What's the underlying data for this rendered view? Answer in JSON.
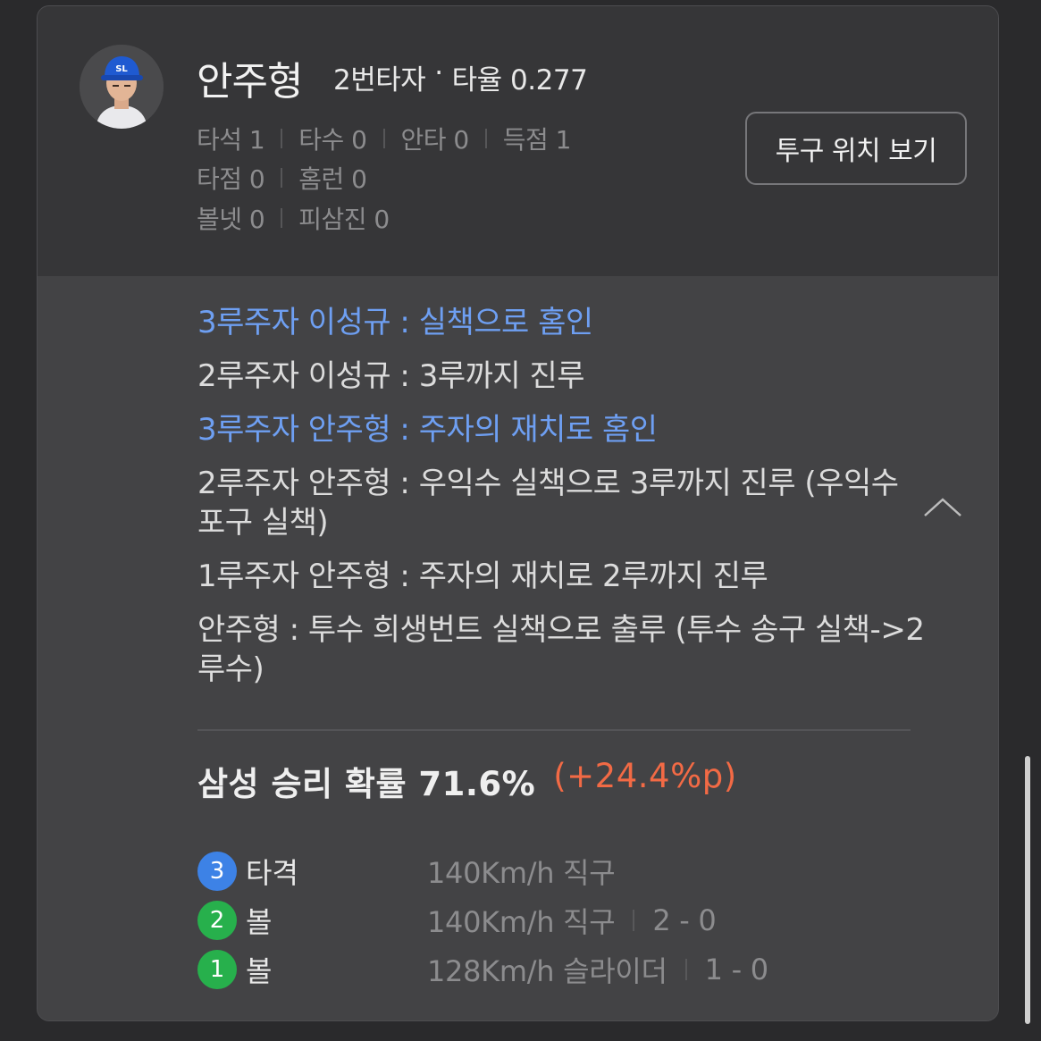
{
  "player": {
    "name": "안주형",
    "order": "2번타자",
    "dot": "·",
    "avg": "타율 0.277",
    "stats": [
      [
        "타석 1",
        "타수 0",
        "안타 0",
        "득점 1"
      ],
      [
        "타점 0",
        "홈런 0"
      ],
      [
        "볼넷 0",
        "피삼진 0"
      ]
    ]
  },
  "buttons": {
    "pitch_location": "투구 위치 보기"
  },
  "events": [
    {
      "text": "3루주자 이성규 : 실책으로 홈인",
      "highlight": true
    },
    {
      "text": "2루주자 이성규 : 3루까지 진루",
      "highlight": false
    },
    {
      "text": "3루주자 안주형 : 주자의 재치로 홈인",
      "highlight": true
    },
    {
      "text": "2루주자 안주형 : 우익수 실책으로 3루까지 진루 (우익수 포구 실책)",
      "highlight": false
    },
    {
      "text": "1루주자 안주형 : 주자의 재치로 2루까지 진루",
      "highlight": false
    },
    {
      "text": "안주형 : 투수 희생번트 실책으로 출루 (투수 송구 실책->2루수)",
      "highlight": false
    }
  ],
  "win_probability": {
    "label": "삼성 승리 확률 71.6%",
    "delta": "(+24.4%p)"
  },
  "pitches": [
    {
      "num": "3",
      "result": "타격",
      "speed": "140Km/h 직구",
      "count": "",
      "color": "#3d82e6"
    },
    {
      "num": "2",
      "result": "볼",
      "speed": "140Km/h 직구",
      "count": "2 - 0",
      "color": "#27b04c"
    },
    {
      "num": "1",
      "result": "볼",
      "speed": "128Km/h 슬라이더",
      "count": "1 - 0",
      "color": "#27b04c"
    }
  ],
  "colors": {
    "highlight": "#6e9ff2",
    "delta": "#f26a45",
    "ball": "#27b04c",
    "hit": "#3d82e6"
  }
}
